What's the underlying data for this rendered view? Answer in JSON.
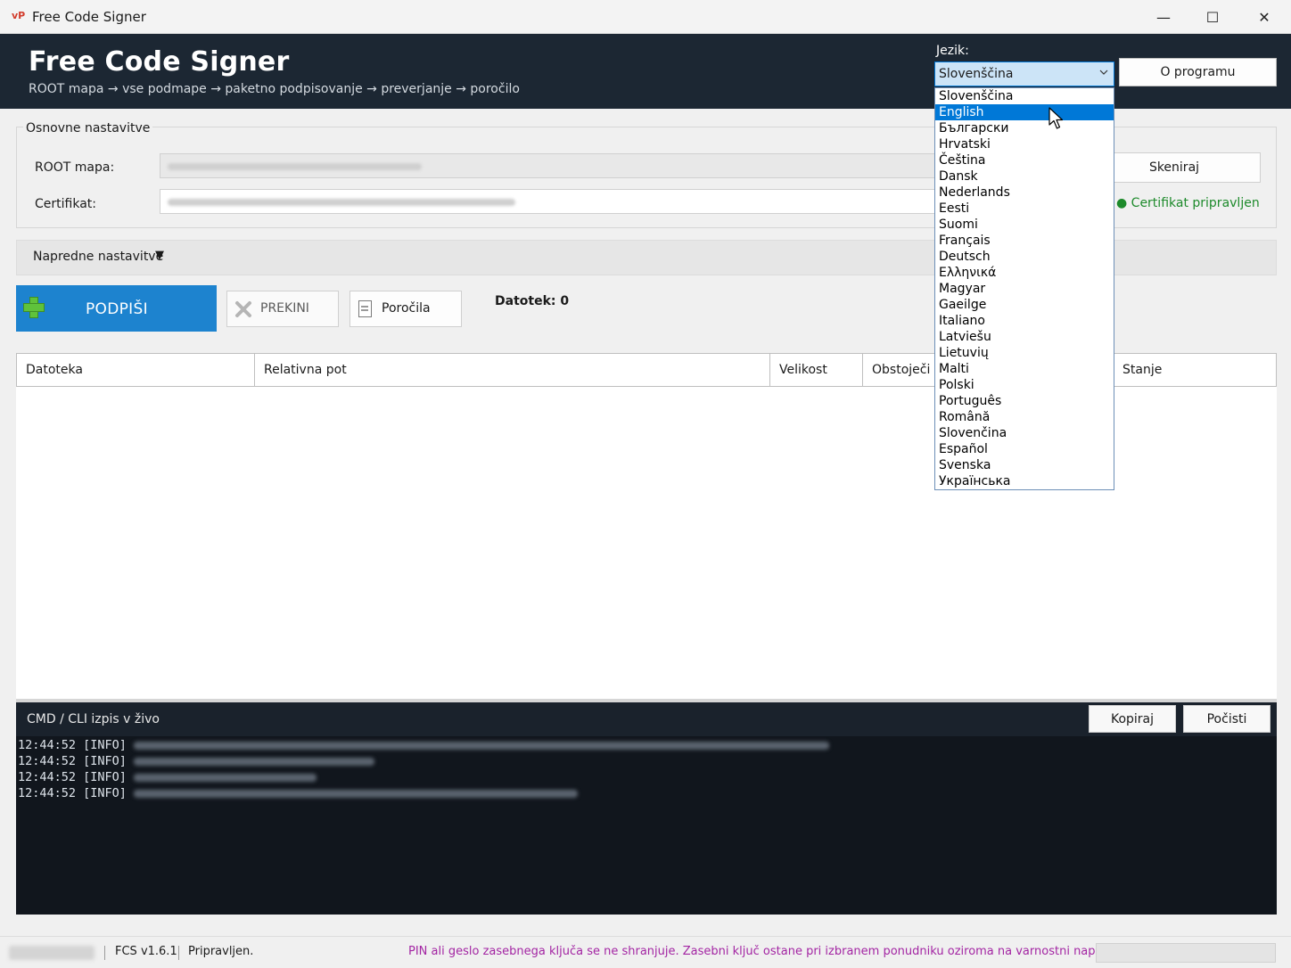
{
  "window": {
    "icon_text": "vP",
    "title": "Free Code Signer",
    "minimize": "—",
    "maximize": "☐",
    "close": "✕"
  },
  "header": {
    "title": "Free Code Signer",
    "subtitle": "ROOT mapa → vse podmape → paketno podpisovanje → preverjanje → poročilo",
    "language_label": "Jezik:",
    "language_selected": "Slovenščina",
    "about_button": "O programu"
  },
  "basic_settings": {
    "legend": "Osnovne nastavitve",
    "root_label": "ROOT mapa:",
    "certificate_label": "Certifikat:",
    "scan_button": "Skeniraj",
    "certificate_status": "● Certifikat pripravljen"
  },
  "advanced": {
    "label": "Napredne nastavitve",
    "arrow": "▼"
  },
  "actions": {
    "sign_button": "PODPIŠI",
    "cancel_button": "PREKINI",
    "reports_button": "Poročila",
    "file_count": "Datotek: 0"
  },
  "table": {
    "columns": [
      "Datoteka",
      "Relativna pot",
      "Velikost",
      "Obstoječi",
      "Stanje"
    ]
  },
  "console": {
    "title": "CMD / CLI izpis v živo",
    "copy_button": "Kopiraj",
    "clear_button": "Počisti",
    "lines": [
      "12:44:52 [INFO]",
      "12:44:52 [INFO]",
      "12:44:52 [INFO]",
      "12:44:52 [INFO]"
    ]
  },
  "statusbar": {
    "version": "FCS v1.6.1",
    "status": "Pripravljen.",
    "notice": "PIN ali geslo zasebnega ključa se ne shranjuje. Zasebni ključ ostane pri izbranem ponudniku oziroma na varnostni napravi."
  },
  "language_dropdown": {
    "highlighted": "English",
    "options": [
      "Slovenščina",
      "English",
      "Български",
      "Hrvatski",
      "Čeština",
      "Dansk",
      "Nederlands",
      "Eesti",
      "Suomi",
      "Français",
      "Deutsch",
      "Ελληνικά",
      "Magyar",
      "Gaeilge",
      "Italiano",
      "Latviešu",
      "Lietuvių",
      "Malti",
      "Polski",
      "Português",
      "Română",
      "Slovenčina",
      "Español",
      "Svenska",
      "Українська"
    ]
  },
  "colors": {
    "header_bg": "#1c2733",
    "accent": "#1d83cf",
    "selection": "#0078d7",
    "ok_green": "#1d8a2b",
    "notice_purple": "#a325a3",
    "console_bg": "#11161d"
  }
}
